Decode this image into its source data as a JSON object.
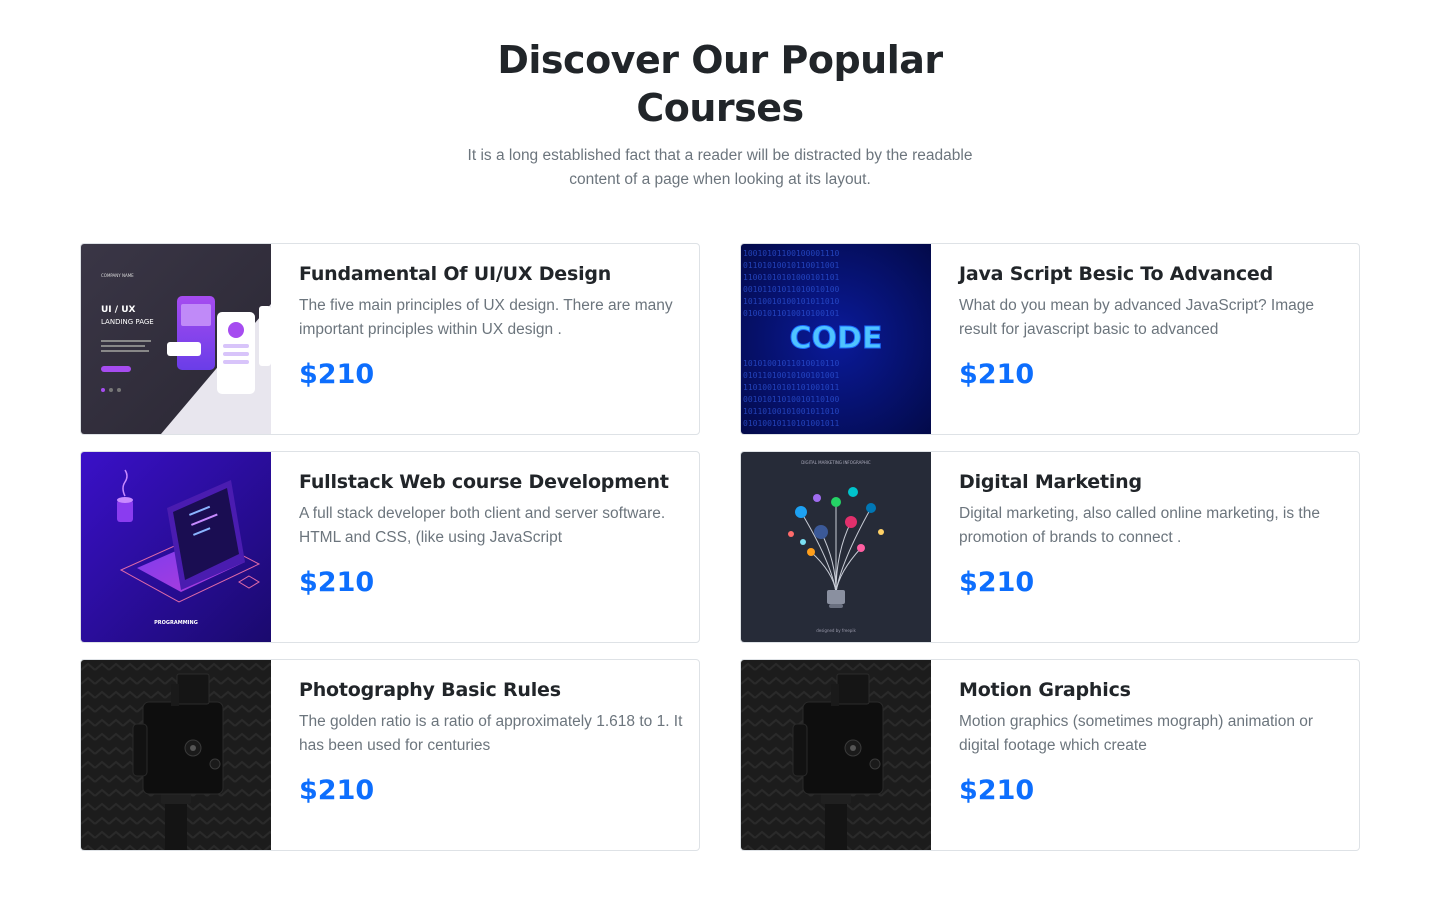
{
  "section": {
    "title": "Discover Our Popular Courses",
    "subtitle": "It is a long established fact that a reader will be distracted by the readable content of a page when looking at its layout."
  },
  "courses": [
    {
      "title": "Fundamental Of UI/UX Design",
      "description": "The five main principles of UX design. There are many important principles within UX design .",
      "price": "$210",
      "image": "ui-ux-landing-page-illustration",
      "image_text": {
        "company": "COMPANY NAME",
        "heading": "UI / UX",
        "subheading": "LANDING PAGE"
      }
    },
    {
      "title": "Java Script Besic To Advanced",
      "description": "What do you mean by advanced JavaScript? Image result for javascript basic to advanced",
      "price": "$210",
      "image": "binary-code-illustration",
      "image_text": {
        "word": "CODE"
      }
    },
    {
      "title": "Fullstack Web course Development",
      "description": "A full stack developer both client and server software. HTML and CSS, (like using JavaScript",
      "price": "$210",
      "image": "isometric-laptop-illustration",
      "image_text": {
        "caption": "PROGRAMMING"
      }
    },
    {
      "title": "Digital Marketing",
      "description": "Digital marketing, also called online marketing, is the promotion of brands to connect .",
      "price": "$210",
      "image": "marketing-lightbulb-infographic",
      "image_text": {
        "heading": "DIGITAL MARKETING INFOGRAPHIC",
        "credit": "designed by freepik"
      }
    },
    {
      "title": "Photography Basic Rules",
      "description": "The golden ratio is a ratio of approximately 1.618 to 1. It has been used for centuries",
      "price": "$210",
      "image": "camera-photo"
    },
    {
      "title": "Motion Graphics",
      "description": "Motion graphics (sometimes mograph) animation or digital footage which create",
      "price": "$210",
      "image": "camera-photo"
    }
  ],
  "colors": {
    "price": "#0d6efd",
    "heading": "#212529",
    "muted": "#6c757d",
    "border": "#dee2e6"
  }
}
